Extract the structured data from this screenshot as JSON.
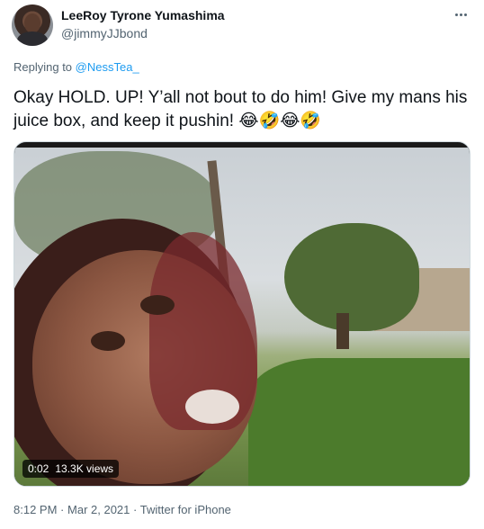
{
  "author": {
    "name": "LeeRoy Tyrone Yumashima",
    "handle": "@jimmyJJbond"
  },
  "reply": {
    "prefix": "Replying to",
    "mention": "@NessTea_"
  },
  "tweet": {
    "text": "Okay HOLD. UP! Y’all not bout to do him! Give my mans his juice box, and keep it pushin! 😂🤣😂🤣"
  },
  "media": {
    "duration": "0:02",
    "views": "13.3K views"
  },
  "meta": {
    "time": "8:12 PM",
    "date": "Mar 2, 2021",
    "source": "Twitter for iPhone",
    "separator": "·"
  },
  "colors": {
    "link": "#1d9bf0",
    "secondary_text": "#536471",
    "primary_text": "#0f1419"
  }
}
